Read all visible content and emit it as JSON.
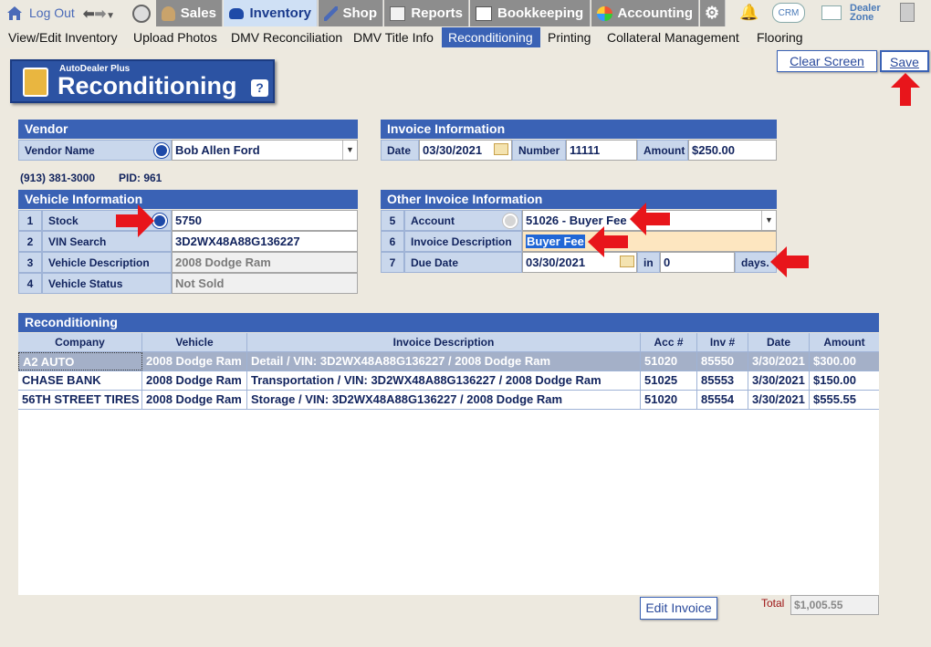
{
  "nav": {
    "logout": "Log Out",
    "items": [
      {
        "label": "Sales",
        "icon": "sales-person-icon"
      },
      {
        "label": "Inventory",
        "icon": "car-icon",
        "active": true
      },
      {
        "label": "Shop",
        "icon": "wrench-icon"
      },
      {
        "label": "Reports",
        "icon": "report-icon"
      },
      {
        "label": "Bookkeeping",
        "icon": "book-icon"
      },
      {
        "label": "Accounting",
        "icon": "pie-chart-icon"
      }
    ],
    "crm": "CRM",
    "dealer_zone_1": "Dealer",
    "dealer_zone_2": "Zone"
  },
  "subnav": [
    "View/Edit Inventory",
    "Upload Photos",
    "DMV Reconciliation",
    "DMV Title Info",
    "Reconditioning",
    "Printing",
    "Collateral Management",
    "Flooring"
  ],
  "page": {
    "brand": "AutoDealer Plus",
    "title": "Reconditioning",
    "help": "?"
  },
  "buttons": {
    "clear": "Clear Screen",
    "save": "Save",
    "edit_invoice": "Edit Invoice"
  },
  "vendor": {
    "header": "Vendor",
    "name_label": "Vendor Name",
    "name_value": "Bob Allen Ford",
    "phone": "(913) 381-3000",
    "pid": "PID: 961"
  },
  "invoice": {
    "header": "Invoice Information",
    "date_label": "Date",
    "date_value": "03/30/2021",
    "number_label": "Number",
    "number_value": "11111",
    "amount_label": "Amount",
    "amount_value": "$250.00"
  },
  "vehicle": {
    "header": "Vehicle Information",
    "rows": [
      {
        "num": "1",
        "label": "Stock",
        "value": "5750"
      },
      {
        "num": "2",
        "label": "VIN Search",
        "value": "3D2WX48A88G136227"
      },
      {
        "num": "3",
        "label": "Vehicle Description",
        "value": "2008 Dodge Ram"
      },
      {
        "num": "4",
        "label": "Vehicle Status",
        "value": "Not Sold"
      }
    ]
  },
  "other": {
    "header": "Other Invoice Information",
    "rows": [
      {
        "num": "5",
        "label": "Account",
        "value": "51026 - Buyer Fee"
      },
      {
        "num": "6",
        "label": "Invoice Description",
        "value": "Buyer Fee"
      },
      {
        "num": "7",
        "label": "Due Date",
        "value": "03/30/2021"
      }
    ],
    "in_label": "in",
    "in_value": "0",
    "days_label": "days."
  },
  "recon": {
    "header": "Reconditioning",
    "columns": [
      "Company",
      "Vehicle",
      "Invoice Description",
      "Acc #",
      "Inv #",
      "Date",
      "Amount"
    ],
    "rows": [
      [
        "A2 AUTO",
        "2008 Dodge Ram",
        "Detail  / VIN: 3D2WX48A88G136227 / 2008 Dodge Ram",
        "51020",
        "85550",
        "3/30/2021",
        "$300.00"
      ],
      [
        "CHASE BANK",
        "2008 Dodge Ram",
        "Transportation / VIN: 3D2WX48A88G136227 / 2008 Dodge Ram",
        "51025",
        "85553",
        "3/30/2021",
        "$150.00"
      ],
      [
        "56TH STREET TIRES",
        "2008 Dodge Ram",
        "Storage / VIN: 3D2WX48A88G136227 / 2008 Dodge Ram",
        "51020",
        "85554",
        "3/30/2021",
        "$555.55"
      ]
    ],
    "total_label": "Total",
    "total_value": "$1,005.55"
  },
  "colors": {
    "accent": "#3a62b5",
    "label_bg": "#c9d7ec",
    "arrow": "#e8151b"
  }
}
